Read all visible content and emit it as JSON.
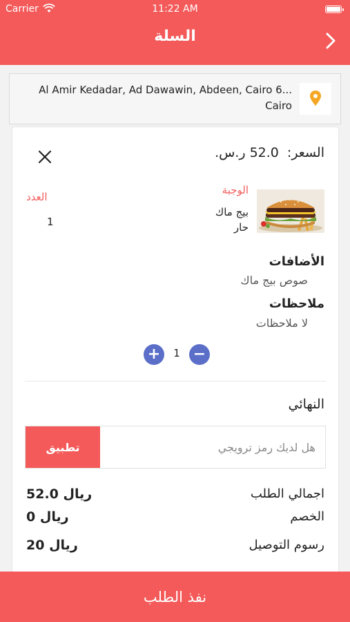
{
  "status_bar": {
    "carrier": "Carrier",
    "time": "11:22 AM"
  },
  "header": {
    "title": "السلة"
  },
  "address": {
    "line1": "Al Amir Kedadar, Ad Dawawin, Abdeen, Cairo 6...",
    "line2": "Cairo"
  },
  "item": {
    "price_label": "السعر:",
    "price_value": "52.0 ر.س.",
    "meal_label": "الوجبة",
    "meal_name_line1": "بيج ماك",
    "meal_name_line2": "حار",
    "qty_label": "العدد",
    "qty_value": "1"
  },
  "addons": {
    "title": "الأضافات",
    "value": "صوص بيج ماك"
  },
  "notes": {
    "title": "ملاحظات",
    "value": "لا ملاحظات"
  },
  "stepper": {
    "count": "1",
    "plus": "+",
    "minus": "−"
  },
  "summary": {
    "title": "النهائي",
    "promo_placeholder": "هل لديك رمز ترويجي",
    "apply_label": "تطبيق",
    "rows": [
      {
        "label": "اجمالي الطلب",
        "value": "52.0 ريال"
      },
      {
        "label": "الخصم",
        "value": "0 ريال"
      },
      {
        "label": "رسوم التوصيل",
        "value": "20 ريال"
      }
    ]
  },
  "checkout_label": "نفذ الطلب",
  "colors": {
    "accent": "#f45a5a",
    "stepper": "#5b6fc9",
    "pin": "#f5a623"
  }
}
